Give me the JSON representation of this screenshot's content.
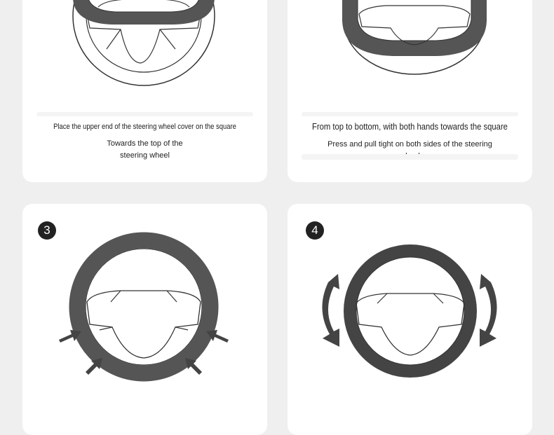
{
  "steps": [
    {
      "caption": "Place the upper end of the steering wheel cover on the square",
      "sub": [
        "Towards the top of the",
        "steering wheel"
      ]
    },
    {
      "caption": "From top to bottom, with both hands towards the square",
      "sub": [
        "Press and pull tight on both sides of the steering",
        "wheel"
      ]
    },
    {
      "badge": "3"
    },
    {
      "badge": "4"
    }
  ],
  "colors": {
    "cover": "#555555",
    "outline": "#333333",
    "background": "#efefef",
    "card": "#ffffff"
  },
  "icons": [
    "steering-wheel-icon",
    "arrow-icon",
    "rotate-arrow-icon"
  ]
}
